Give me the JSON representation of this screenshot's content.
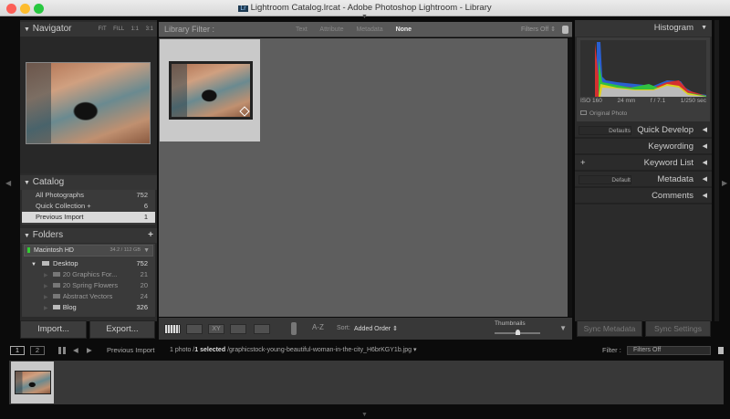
{
  "window": {
    "title": "Lightroom Catalog.lrcat - Adobe Photoshop Lightroom - Library",
    "app_icon": "Lr"
  },
  "navigator": {
    "title": "Navigator",
    "zoom": [
      "FIT",
      "FILL",
      "1:1",
      "3:1"
    ]
  },
  "catalog": {
    "title": "Catalog",
    "items": [
      {
        "label": "All Photographs",
        "count": "752"
      },
      {
        "label": "Quick Collection +",
        "count": "6"
      },
      {
        "label": "Previous Import",
        "count": "1"
      }
    ]
  },
  "folders": {
    "title": "Folders",
    "add": "+",
    "volume": {
      "name": "Macintosh HD",
      "usage": "34.2 / 112 GB"
    },
    "items": [
      {
        "label": "Desktop",
        "count": "752"
      },
      {
        "label": "20 Graphics For...",
        "count": "21"
      },
      {
        "label": "20 Spring Flowers",
        "count": "20"
      },
      {
        "label": "Abstract Vectors",
        "count": "24"
      },
      {
        "label": "Blog",
        "count": "326"
      }
    ]
  },
  "buttons": {
    "import": "Import...",
    "export": "Export...",
    "sync_metadata": "Sync Metadata",
    "sync_settings": "Sync Settings"
  },
  "filter_bar": {
    "label": "Library Filter :",
    "tabs": [
      "Text",
      "Attribute",
      "Metadata",
      "None"
    ],
    "active": "None",
    "preset": "Filters Off"
  },
  "toolbar": {
    "sort_label": "Sort:",
    "sort_value": "Added Order",
    "thumbnails_label": "Thumbnails",
    "thumbnail_size": 0.5,
    "sort_icon": "A-Z"
  },
  "histogram": {
    "title": "Histogram",
    "iso": "ISO 160",
    "focal": "24 mm",
    "aperture": "f / 7.1",
    "shutter": "1/250 sec",
    "original_photo": "Original Photo"
  },
  "right_panels": [
    {
      "label": "Quick Develop",
      "select": "Defaults"
    },
    {
      "label": "Keywording"
    },
    {
      "label": "Keyword List",
      "plus": "+"
    },
    {
      "label": "Metadata",
      "select": "Default"
    },
    {
      "label": "Comments"
    }
  ],
  "filmstrip": {
    "screens": [
      "1",
      "2"
    ],
    "source": "Previous Import",
    "count": "1 photo /",
    "selected": "1 selected",
    "path": "/graphicstock-young-beautiful-woman-in-the-city_H6brKGY1b.jpg",
    "filter_label": "Filter :",
    "filter_value": "Filters Off"
  }
}
